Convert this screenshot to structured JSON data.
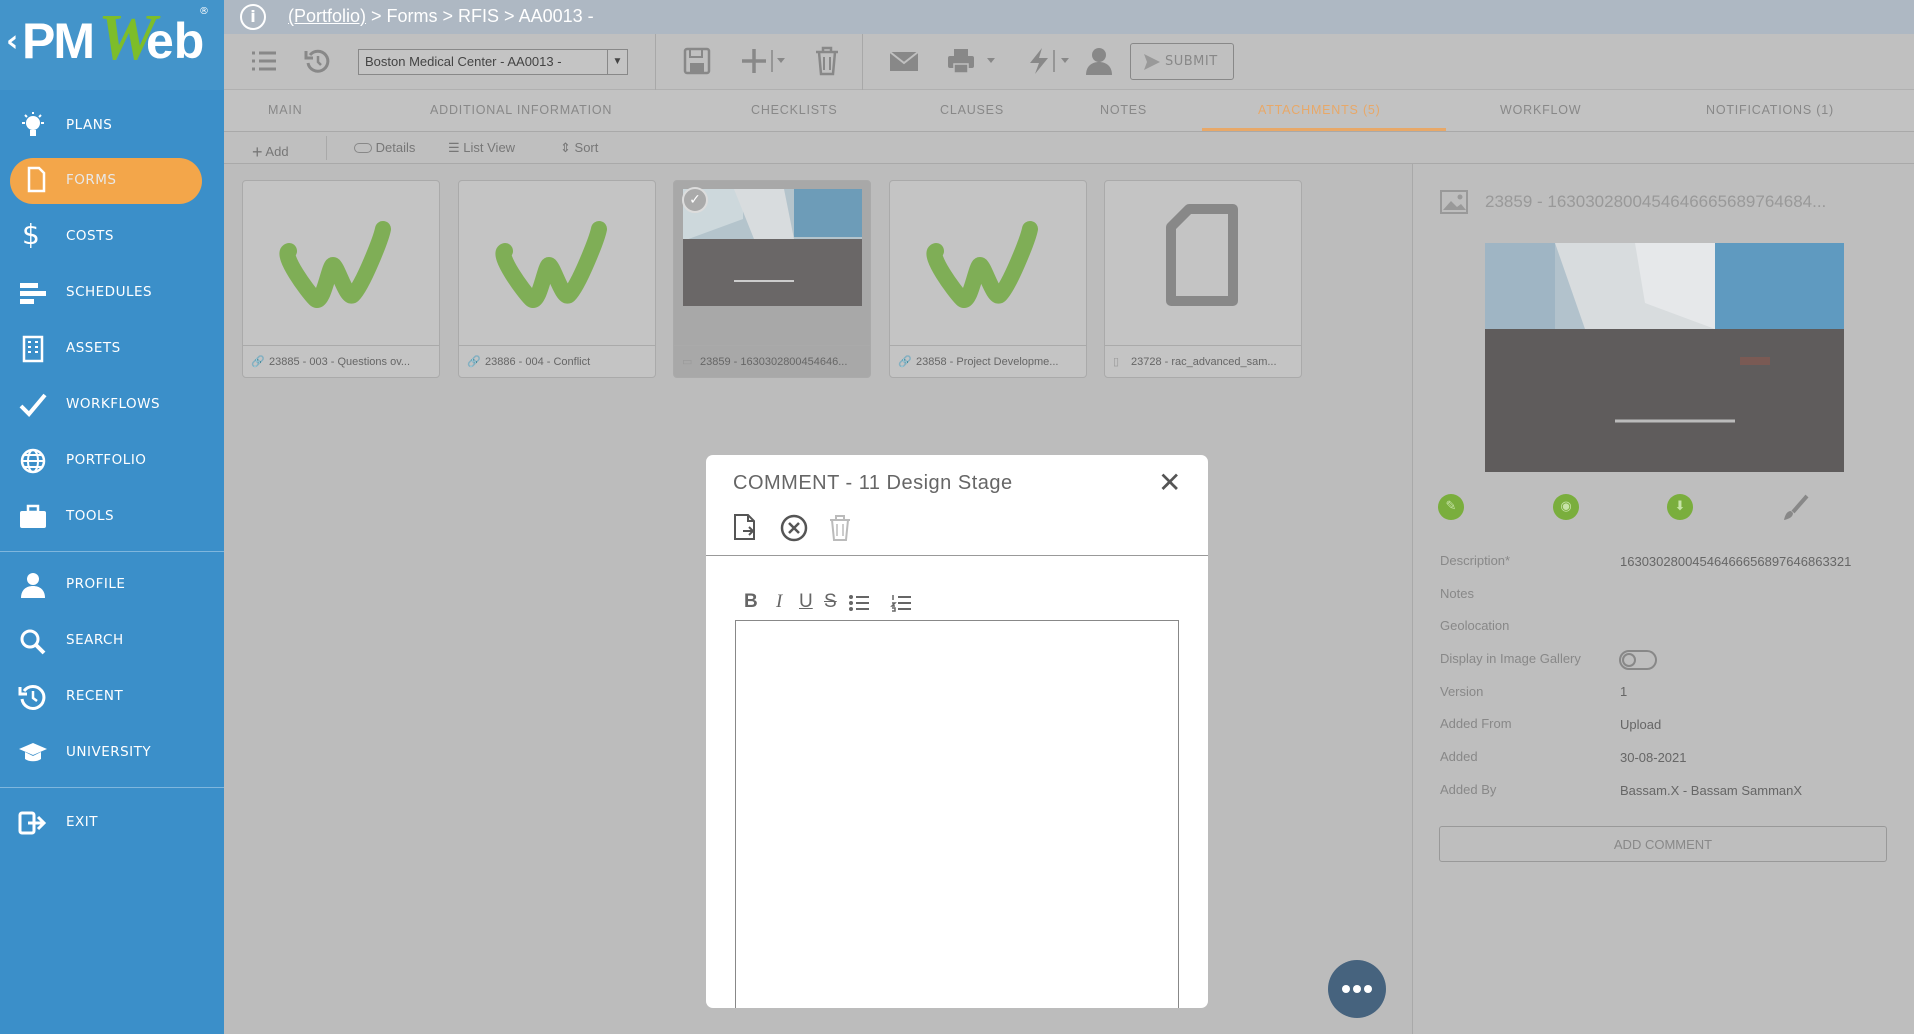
{
  "app": {
    "logo_text": "PMWeb"
  },
  "sidebar": {
    "items": [
      {
        "label": "PLANS",
        "icon": "bulb-icon"
      },
      {
        "label": "FORMS",
        "icon": "document-icon",
        "active": true
      },
      {
        "label": "COSTS",
        "icon": "dollar-icon"
      },
      {
        "label": "SCHEDULES",
        "icon": "gantt-icon"
      },
      {
        "label": "ASSETS",
        "icon": "building-icon"
      },
      {
        "label": "WORKFLOWS",
        "icon": "checkmark-icon"
      },
      {
        "label": "PORTFOLIO",
        "icon": "globe-icon"
      },
      {
        "label": "TOOLS",
        "icon": "briefcase-icon"
      },
      {
        "label": "PROFILE",
        "icon": "user-icon"
      },
      {
        "label": "SEARCH",
        "icon": "search-icon"
      },
      {
        "label": "RECENT",
        "icon": "history-icon"
      },
      {
        "label": "UNIVERSITY",
        "icon": "graduation-cap-icon"
      },
      {
        "label": "EXIT",
        "icon": "exit-icon"
      }
    ]
  },
  "breadcrumb": {
    "portfolio": "(Portfolio)",
    "rest": " > Forms > RFIS > AA0013 -"
  },
  "toolbar": {
    "project": "Boston Medical Center - AA0013 -",
    "submit": "SUBMIT"
  },
  "tabs": [
    "MAIN",
    "ADDITIONAL INFORMATION",
    "CHECKLISTS",
    "CLAUSES",
    "NOTES",
    "ATTACHMENTS (5)",
    "WORKFLOW",
    "NOTIFICATIONS (1)"
  ],
  "subbar": {
    "add": "Add",
    "details": "Details",
    "list_view": "List View",
    "sort": "Sort"
  },
  "attachments": [
    {
      "caption": "23885 - 003 - Questions ov...",
      "kind": "link"
    },
    {
      "caption": "23886 - 004 - Conflict",
      "kind": "link"
    },
    {
      "caption": "23859 - 1630302800454646...",
      "kind": "image"
    },
    {
      "caption": "23858 - Project Developme...",
      "kind": "link"
    },
    {
      "caption": "23728 - rac_advanced_sam...",
      "kind": "file"
    }
  ],
  "details": {
    "title": "23859 - 1630302800454646665689764684...",
    "labels": {
      "description": "Description*",
      "notes": "Notes",
      "geolocation": "Geolocation",
      "gallery": "Display in Image Gallery",
      "version": "Version",
      "added_from": "Added From",
      "added": "Added",
      "added_by": "Added By"
    },
    "values": {
      "description": "16303028004546466656897646863321",
      "version": "1",
      "added_from": "Upload",
      "added": "30-08-2021",
      "added_by": "Bassam.X - Bassam SammanX"
    },
    "display_in_gallery": false,
    "add_comment": "ADD COMMENT"
  },
  "modal": {
    "title": "COMMENT - 11 Design Stage",
    "editor_value": ""
  },
  "colors": {
    "sidebar": "#3b8fc9",
    "accent": "#f3a64a",
    "green": "#7dbd2a"
  }
}
